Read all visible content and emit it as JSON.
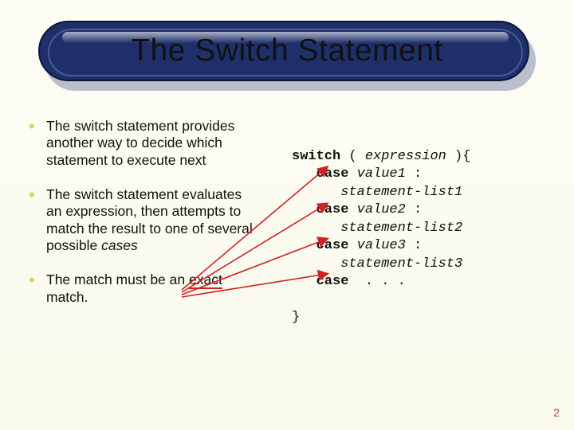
{
  "title": "The Switch Statement",
  "bullets": {
    "b1": "The switch statement provides another way to decide which statement to execute next",
    "b2_pre": "The switch statement evaluates an expression, then attempts to match the result to one of several possible ",
    "b2_em": "cases",
    "b3_pre": "The match must be an ",
    "b3_em": "exact",
    "b3_post": " match."
  },
  "code": {
    "l1_kw": "switch",
    "l1_paren_open": " ( ",
    "l1_expr": "expression",
    "l1_paren_close": " ){",
    "indent1": "   ",
    "case_kw": "case",
    "v1": "value1",
    "colon": " :",
    "s1": "statement-list1",
    "v2": "value2",
    "s2": "statement-list2",
    "v3": "value3",
    "s3": "statement-list3",
    "ellipsis": ". . .",
    "indent2": "      ",
    "close": "}"
  },
  "page_number": "2"
}
